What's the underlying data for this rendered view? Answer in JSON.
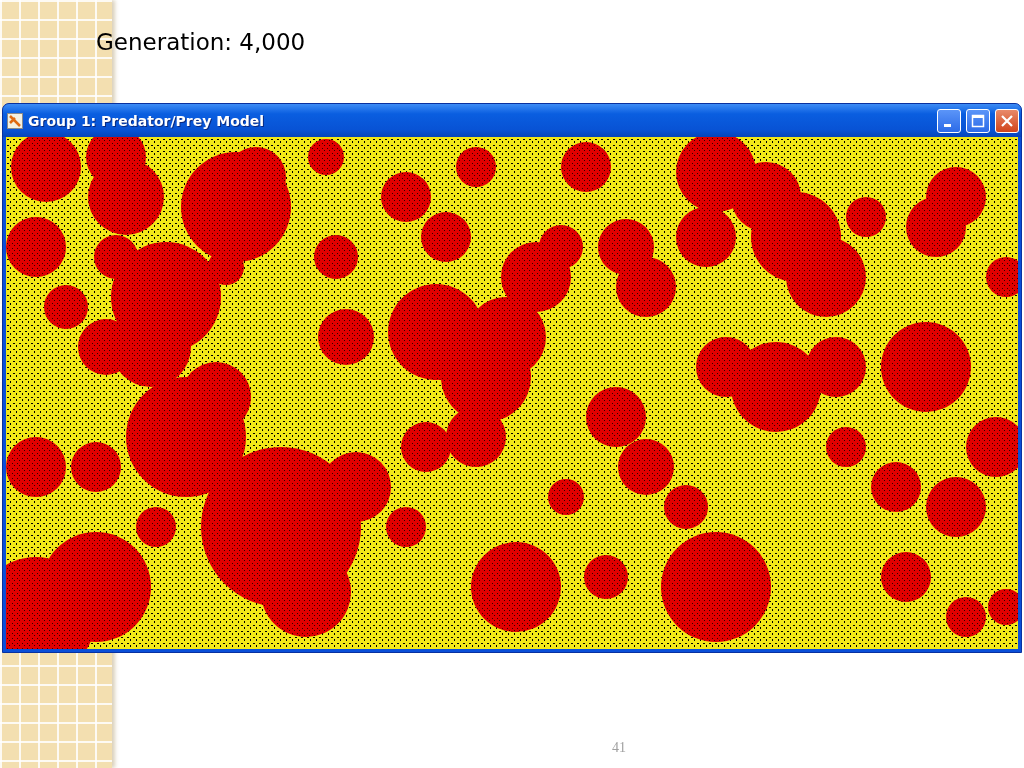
{
  "slide": {
    "heading": "Generation: 4,000",
    "page_number": "41"
  },
  "window": {
    "title": "Group 1: Predator/Prey Model"
  }
}
